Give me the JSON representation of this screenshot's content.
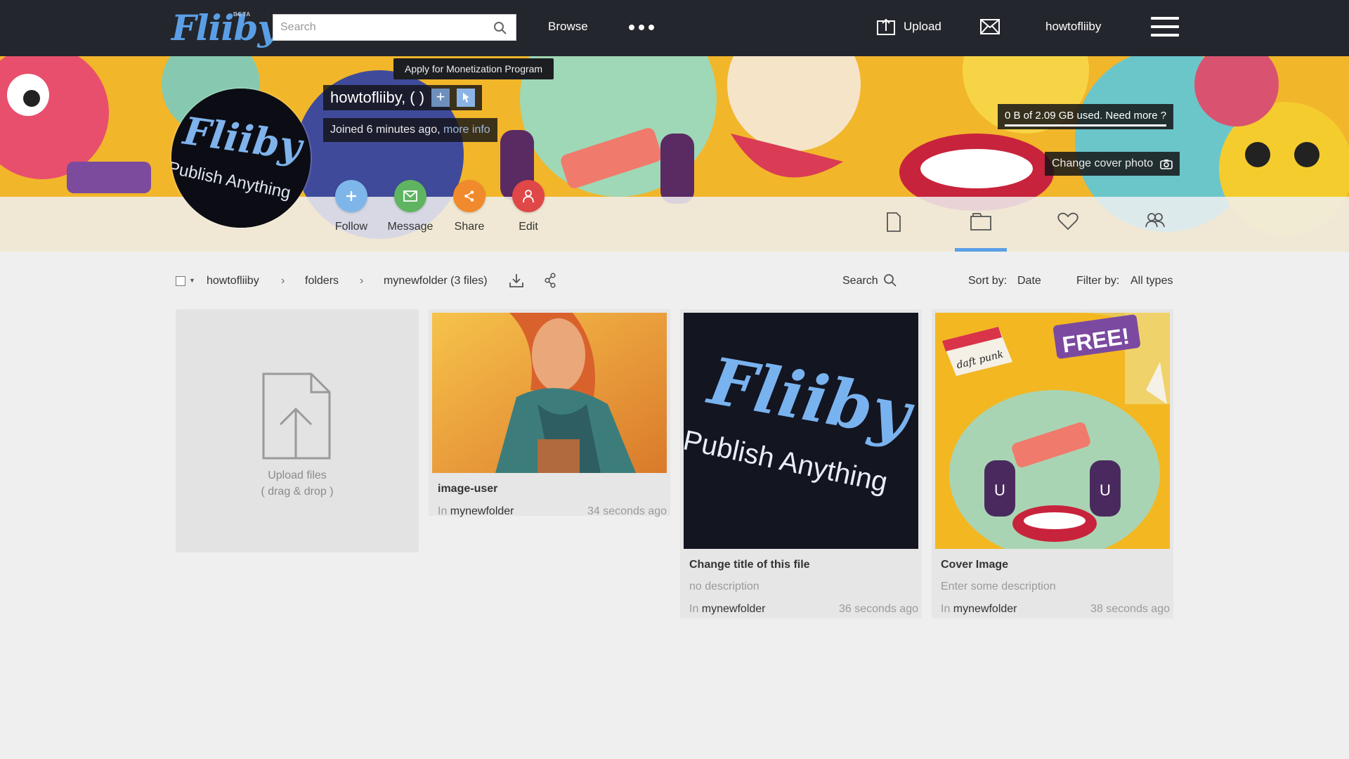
{
  "header": {
    "logo_text": "Fliiby",
    "logo_badge": "BETA",
    "search_placeholder": "Search",
    "browse_label": "Browse",
    "upload_label": "Upload",
    "username": "howtofliiby"
  },
  "profile": {
    "tooltip": "Apply for Monetization Program",
    "display_name": "howtofliiby, ( )",
    "joined_text": "Joined 6 minutes ago,",
    "more_info_label": "more info",
    "storage_text": "0 B of 2.09 GB used. Need more ?",
    "storage_used_fraction": 0,
    "change_cover_label": "Change cover photo",
    "avatar_logo_text": "Fliiby",
    "avatar_tagline": "Publish Anything",
    "actions": {
      "follow": "Follow",
      "message": "Message",
      "share": "Share",
      "edit": "Edit"
    },
    "action_colors": {
      "follow": "#7fb6ea",
      "message": "#5fb462",
      "share": "#f08a2c",
      "edit": "#e04747"
    },
    "tabs": [
      "document-icon",
      "folder-icon",
      "heart-icon",
      "users-icon"
    ],
    "active_tab": "folder-icon"
  },
  "toolbar": {
    "breadcrumb": [
      "howtofliiby",
      "folders",
      "mynewfolder (3 files)"
    ],
    "search_label": "Search",
    "sort_label": "Sort by:",
    "sort_value": "Date",
    "filter_label": "Filter by:",
    "filter_value": "All types"
  },
  "upload_card": {
    "line1": "Upload files",
    "line2": "( drag & drop )"
  },
  "files": [
    {
      "title": "image-user",
      "folder_prefix": "In",
      "folder": "mynewfolder",
      "time": "34 seconds ago"
    },
    {
      "title": "Change title of this file",
      "description": "no description",
      "folder_prefix": "In",
      "folder": "mynewfolder",
      "time": "36 seconds ago",
      "thumb_logo": "Fliiby",
      "thumb_tagline": "Publish Anything"
    },
    {
      "title": "Cover Image",
      "description": "Enter some description",
      "folder_prefix": "In",
      "folder": "mynewfolder",
      "time": "38 seconds ago",
      "thumb_badge": "FREE!",
      "thumb_cap": "daft punk"
    }
  ],
  "accent_color": "#5a9fe6",
  "topbar_color": "#23262c"
}
